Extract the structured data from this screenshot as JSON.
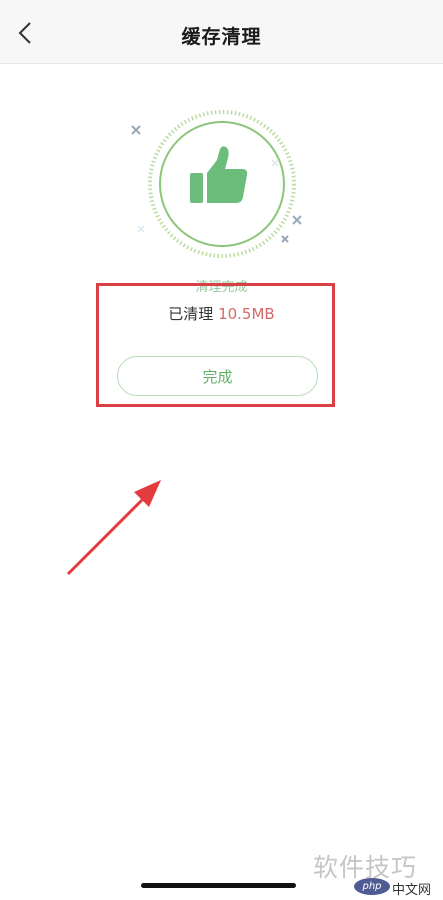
{
  "header": {
    "title": "缓存清理",
    "back_icon": "chevron-left-icon"
  },
  "hero": {
    "icon": "thumbs-up-icon",
    "accent": "#6cbd7c"
  },
  "result": {
    "status": "清理完成",
    "cleaned_prefix": "已清理",
    "cleaned_amount": "10.5MB",
    "amount_color": "#d46a6a"
  },
  "done_button": {
    "label": "完成"
  },
  "annotation": {
    "box_color": "#d93f44",
    "arrow_color": "#e23c3f"
  },
  "watermark": {
    "text": "软件技巧",
    "logo_text": "php",
    "site_text": "中文网"
  }
}
